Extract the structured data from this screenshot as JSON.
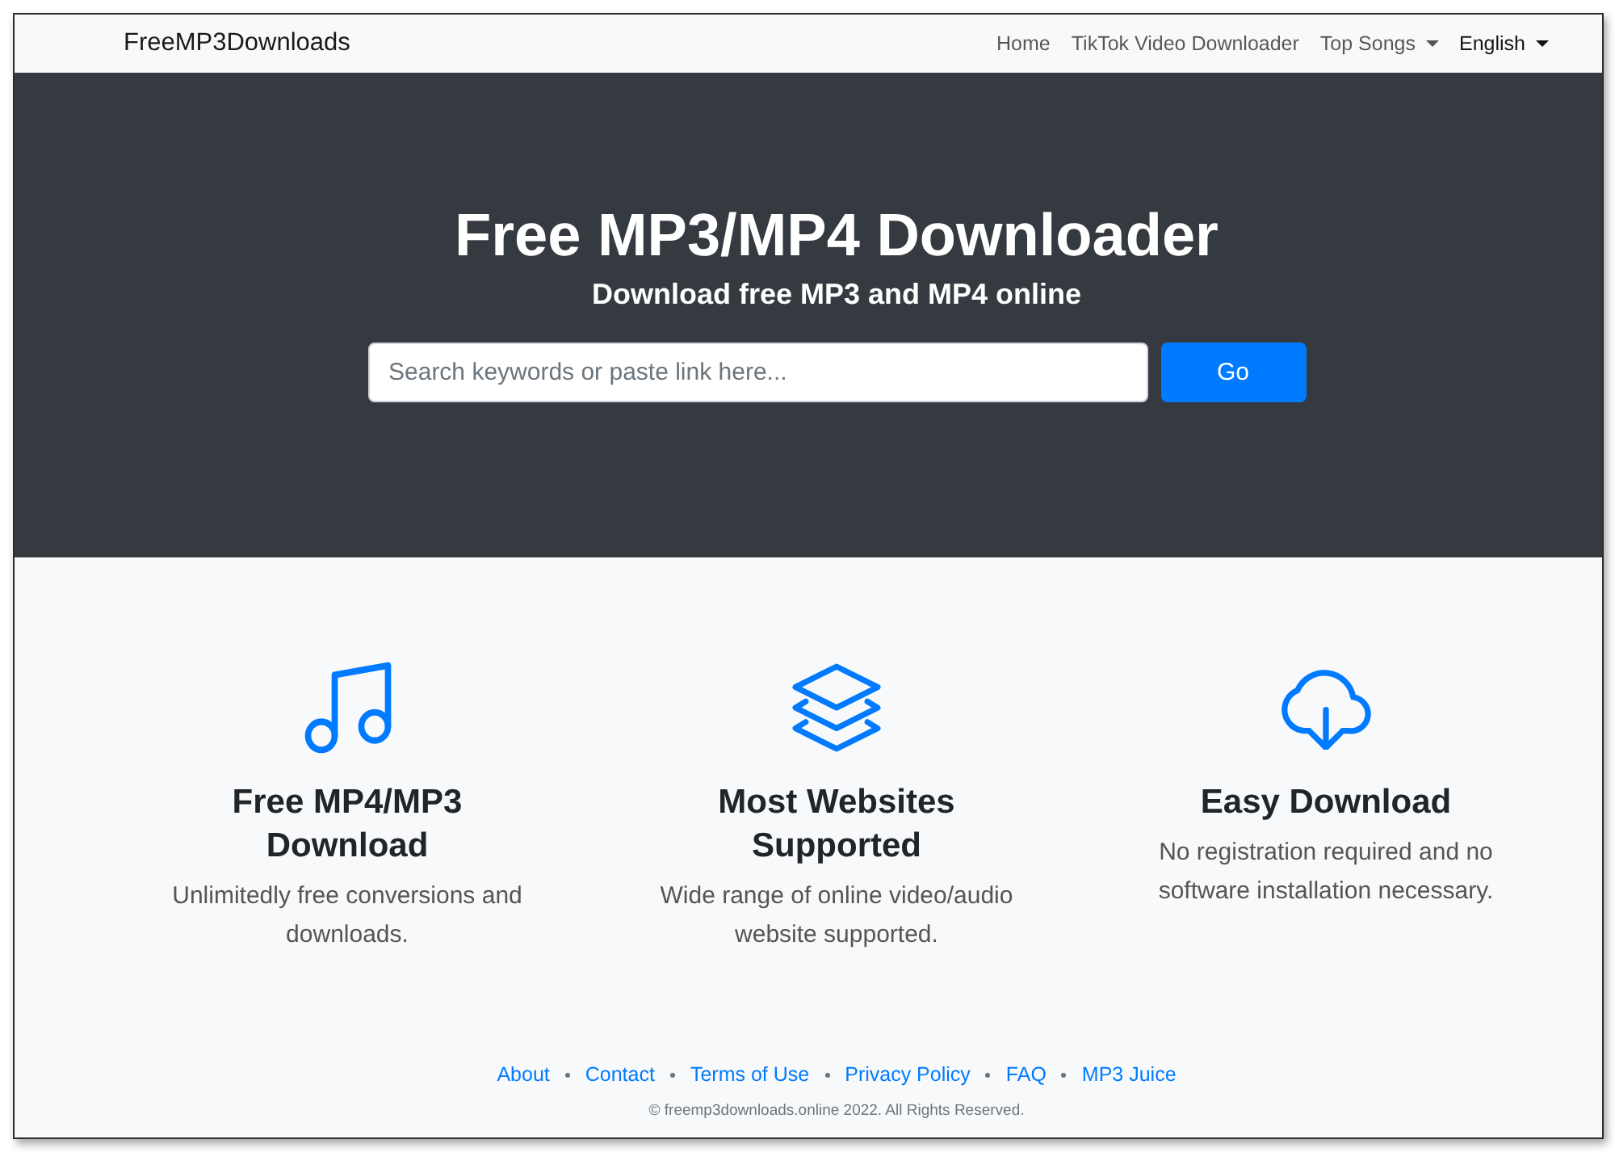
{
  "navbar": {
    "brand": "FreeMP3Downloads",
    "items": [
      {
        "label": "Home",
        "kind": "link",
        "selected": false
      },
      {
        "label": "TikTok Video Downloader",
        "kind": "link",
        "selected": false
      },
      {
        "label": "Top Songs",
        "kind": "dropdown",
        "selected": false
      },
      {
        "label": "English",
        "kind": "dropdown",
        "selected": true
      }
    ]
  },
  "hero": {
    "title": "Free MP3/MP4 Downloader",
    "subtitle": "Download free MP3 and MP4 online",
    "search": {
      "placeholder": "Search keywords or paste link here..."
    },
    "button": "Go"
  },
  "features": [
    {
      "title": "Free MP4/MP3 Download",
      "description": "Unlimitedly free conversions and downloads."
    },
    {
      "title": "Most Websites Supported",
      "description": "Wide range of online video/audio website supported."
    },
    {
      "title": "Easy Download",
      "description": "No registration required and no software installation necessary."
    }
  ],
  "footer": {
    "links": [
      "About",
      "Contact",
      "Terms of Use",
      "Privacy Policy",
      "FAQ",
      "MP3 Juice"
    ],
    "copyright": "© freemp3downloads.online 2022. All Rights Reserved."
  }
}
